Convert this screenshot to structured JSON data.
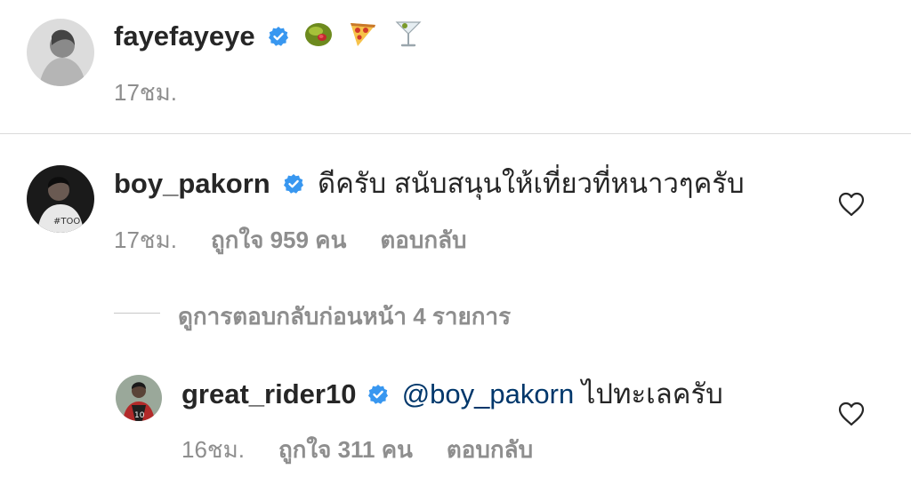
{
  "caption": {
    "username": "fayefayeye",
    "emojis": [
      "olive-icon",
      "pizza-icon",
      "cocktail-icon"
    ],
    "time": "17ชม."
  },
  "comment": {
    "username": "boy_pakorn",
    "text": "ดีครับ สนับสนุนให้เที่ยวที่หนาวๆครับ",
    "time": "17ชม.",
    "likes": "ถูกใจ 959 คน",
    "reply_label": "ตอบกลับ"
  },
  "view_replies": {
    "label": "ดูการตอบกลับก่อนหน้า 4 รายการ"
  },
  "reply": {
    "username": "great_rider10",
    "mention": "@boy_pakorn",
    "text": "ไปทะเลครับ",
    "time": "16ชม.",
    "likes": "ถูกใจ 311 คน",
    "reply_label": "ตอบกลับ"
  },
  "colors": {
    "verified": "#3897f0",
    "mention": "#00376b",
    "meta": "#8e8e8e",
    "divider": "#dbdbdb"
  }
}
